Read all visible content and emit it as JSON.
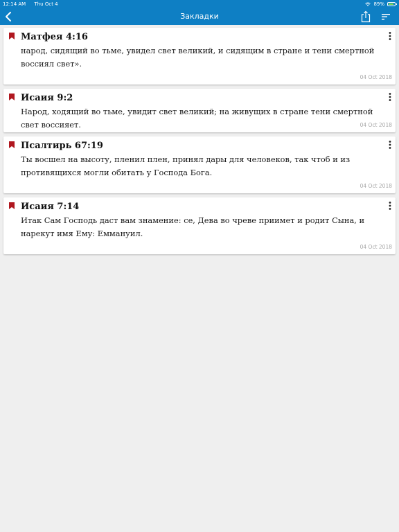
{
  "status_bar": {
    "time": "12:14 AM",
    "date": "Thu Oct 4",
    "battery": "89%"
  },
  "nav": {
    "title": "Закладки",
    "icons": {
      "back": "chevron-left-icon",
      "share": "share-icon",
      "sort": "sort-icon"
    }
  },
  "colors": {
    "bar": "#0e7fc4",
    "bookmark": "#b0171f",
    "background": "#efefef",
    "date": "#a8a8a8"
  },
  "bookmarks": [
    {
      "reference": "Матфея 4:16",
      "text": "народ, сидящий во тьме, увидел свет великий, и сидящим в стране и тени смертной воссиял свет».",
      "date": "04 Oct 2018"
    },
    {
      "reference": "Исаия 9:2",
      "text": "Народ, ходящий во тьме, увидит свет великий; на живущих в стране тени смертной свет воссияет.",
      "date": "04 Oct 2018"
    },
    {
      "reference": "Псалтирь 67:19",
      "text": "Ты восшел на высоту, пленил плен, принял дары для человеков, так чтоб и из противящихся могли обитать у Господа Бога.",
      "date": "04 Oct 2018"
    },
    {
      "reference": "Исаия 7:14",
      "text": "Итак Сам Господь даст вам знамение: се, Дева во чреве приимет и родит Сына, и нарекут имя Ему: Еммануил.",
      "date": "04 Oct 2018"
    }
  ]
}
